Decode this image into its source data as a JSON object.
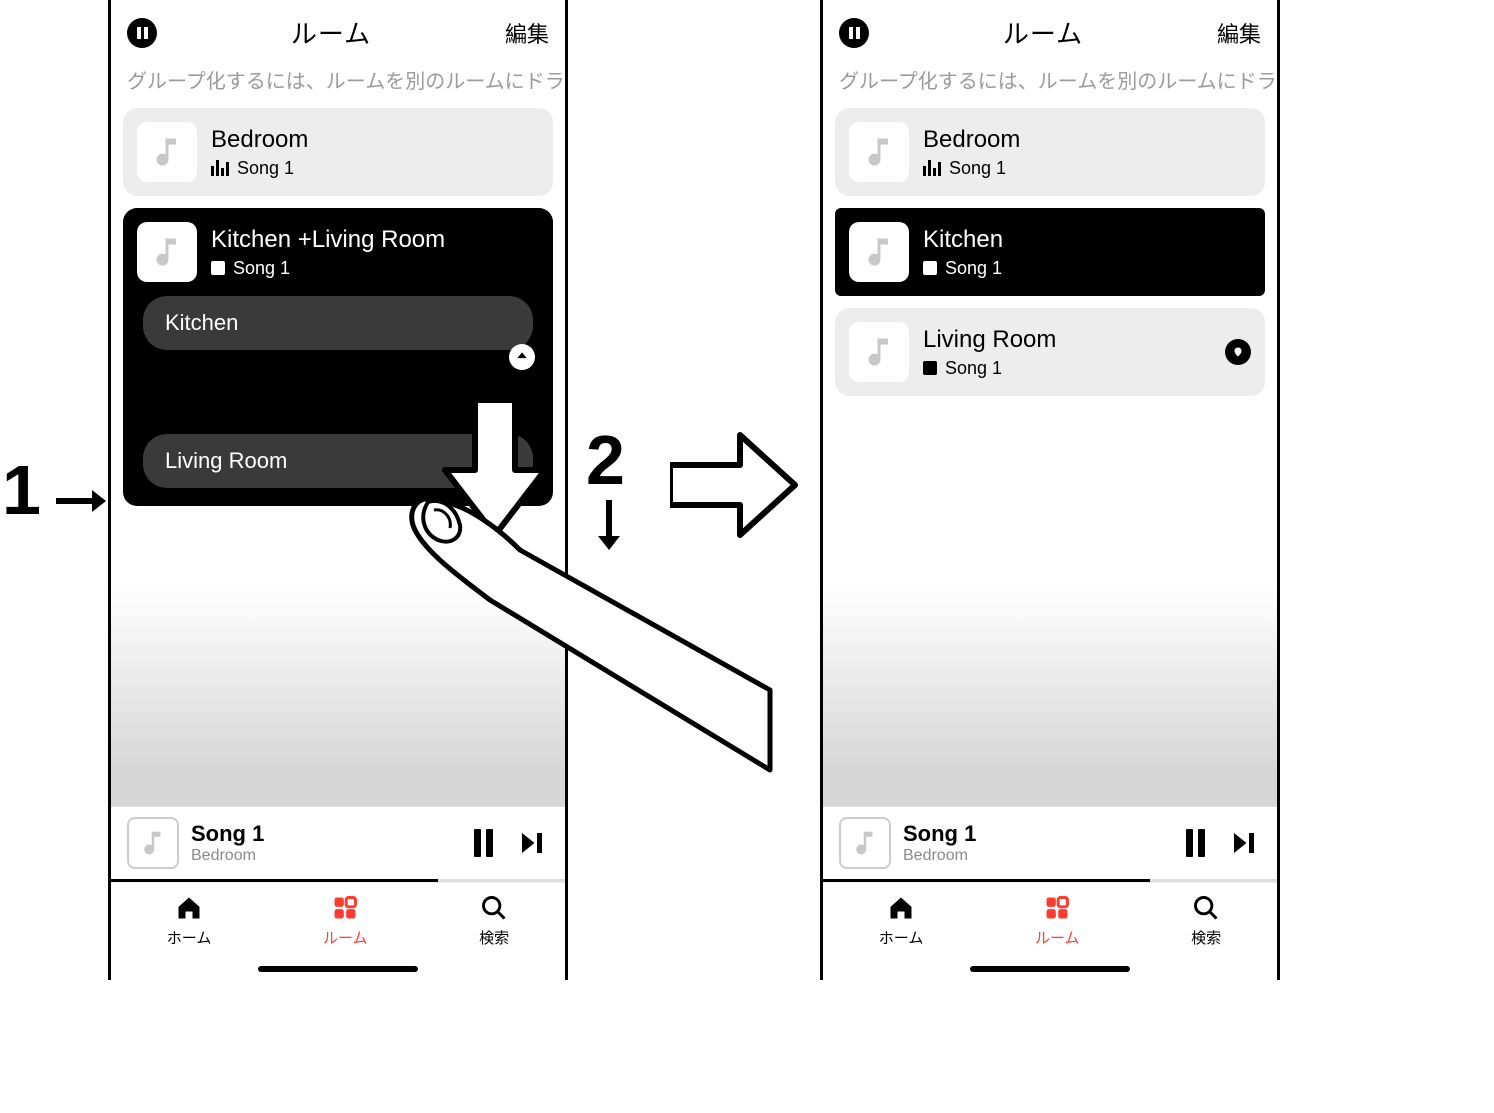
{
  "header": {
    "title": "ルーム",
    "edit": "編集"
  },
  "subtitle": "グループ化するには、ルームを別のルームにドラ",
  "left": {
    "bedroom": {
      "name": "Bedroom",
      "song": "Song 1"
    },
    "group": {
      "name": "Kitchen +Living Room",
      "song": "Song 1",
      "kitchen": "Kitchen",
      "living": "Living Room"
    }
  },
  "right": {
    "bedroom": {
      "name": "Bedroom",
      "song": "Song 1"
    },
    "kitchen": {
      "name": "Kitchen",
      "song": "Song 1"
    },
    "living": {
      "name": "Living Room",
      "song": "Song 1"
    }
  },
  "nowplaying": {
    "title": "Song 1",
    "sub": "Bedroom"
  },
  "tabs": {
    "home": "ホーム",
    "rooms": "ルーム",
    "search": "検索"
  },
  "annotations": {
    "one": "1",
    "two": "2"
  }
}
